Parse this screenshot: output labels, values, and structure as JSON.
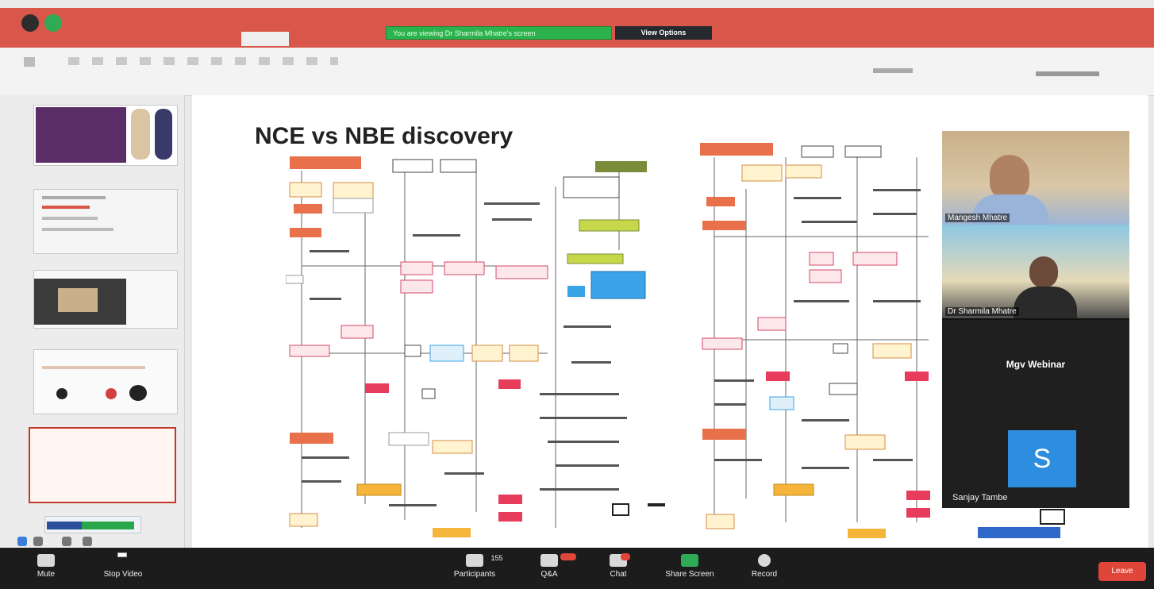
{
  "ribbon": {
    "share_banner": "You are viewing Dr Sharmila Mhatre's screen",
    "view_options": "View Options"
  },
  "slide": {
    "title": "NCE vs NBE discovery"
  },
  "participants": [
    {
      "name": "Mangesh Mhatre"
    },
    {
      "name": "Dr Sharmila Mhatre"
    },
    {
      "name": "Mgv Webinar"
    },
    {
      "name": "Sanjay Tambe",
      "avatar_letter": "S"
    }
  ],
  "meeting_bar": {
    "mute": "Mute",
    "stop_video": "Stop Video",
    "participants": "Participants",
    "participants_count": "155",
    "qa": "Q&A",
    "chat": "Chat",
    "share_screen": "Share Screen",
    "record": "Record",
    "leave": "Leave"
  },
  "colors": {
    "ribbon": "#d9574a",
    "banner_green": "#2bb24c",
    "avatar_blue": "#2d8ee0",
    "leave_red": "#e0453a"
  }
}
